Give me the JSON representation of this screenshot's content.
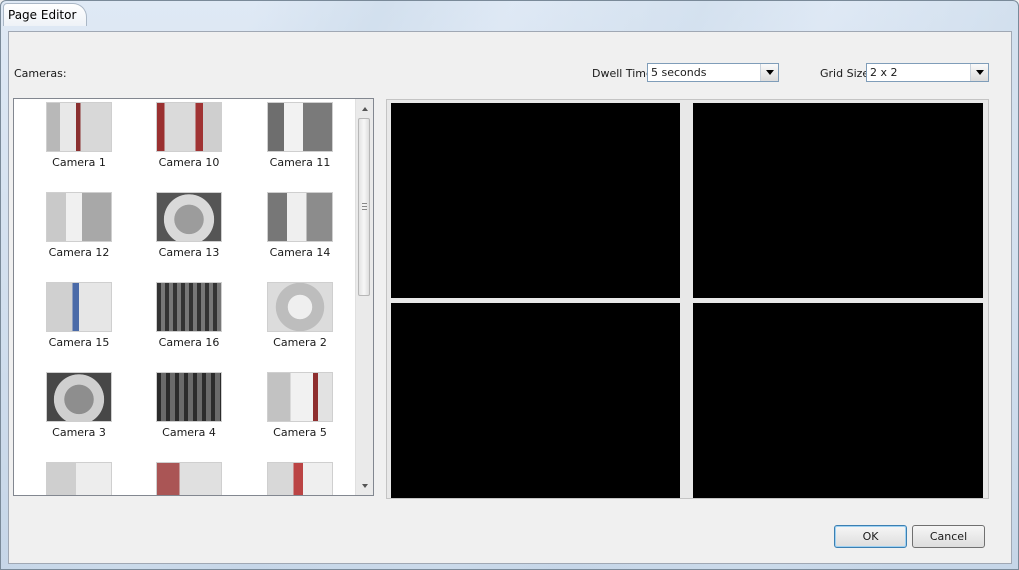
{
  "window": {
    "title": "Page Editor"
  },
  "cameras_label": "Cameras:",
  "dwell": {
    "label": "Dwell Time",
    "value": "5 seconds"
  },
  "grid": {
    "label": "Grid Size",
    "value": "2 x 2"
  },
  "cameras": [
    {
      "name": "Camera 1"
    },
    {
      "name": "Camera 10"
    },
    {
      "name": "Camera 11"
    },
    {
      "name": "Camera 12"
    },
    {
      "name": "Camera 13"
    },
    {
      "name": "Camera 14"
    },
    {
      "name": "Camera 15"
    },
    {
      "name": "Camera 16"
    },
    {
      "name": "Camera 2"
    },
    {
      "name": "Camera 3"
    },
    {
      "name": "Camera 4"
    },
    {
      "name": "Camera 5"
    },
    {
      "name": ""
    },
    {
      "name": ""
    },
    {
      "name": ""
    }
  ],
  "buttons": {
    "ok": "OK",
    "cancel": "Cancel"
  },
  "colors": {
    "grid_cell": "#000000",
    "default_button_border": "#3c7fb1"
  }
}
